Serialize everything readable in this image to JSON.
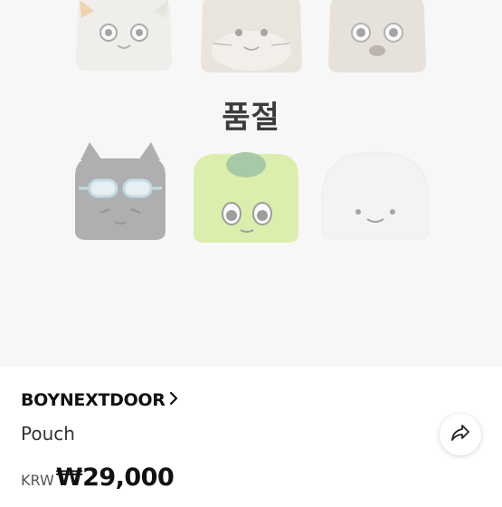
{
  "product_image": {
    "soldout_label": "품절",
    "pouches": [
      {
        "name": "cat-white"
      },
      {
        "name": "hamster"
      },
      {
        "name": "bear"
      },
      {
        "name": "cat-gray-goggles"
      },
      {
        "name": "frog"
      },
      {
        "name": "ghost"
      }
    ]
  },
  "info": {
    "brand": "BOYNEXTDOOR",
    "product_name": "Pouch",
    "currency": "KRW",
    "price": "₩29,000",
    "share_icon": "share-arrow-icon"
  },
  "colors": {
    "image_bg": "#f7f7f7",
    "text_primary": "#111111",
    "text_secondary": "#333333"
  }
}
